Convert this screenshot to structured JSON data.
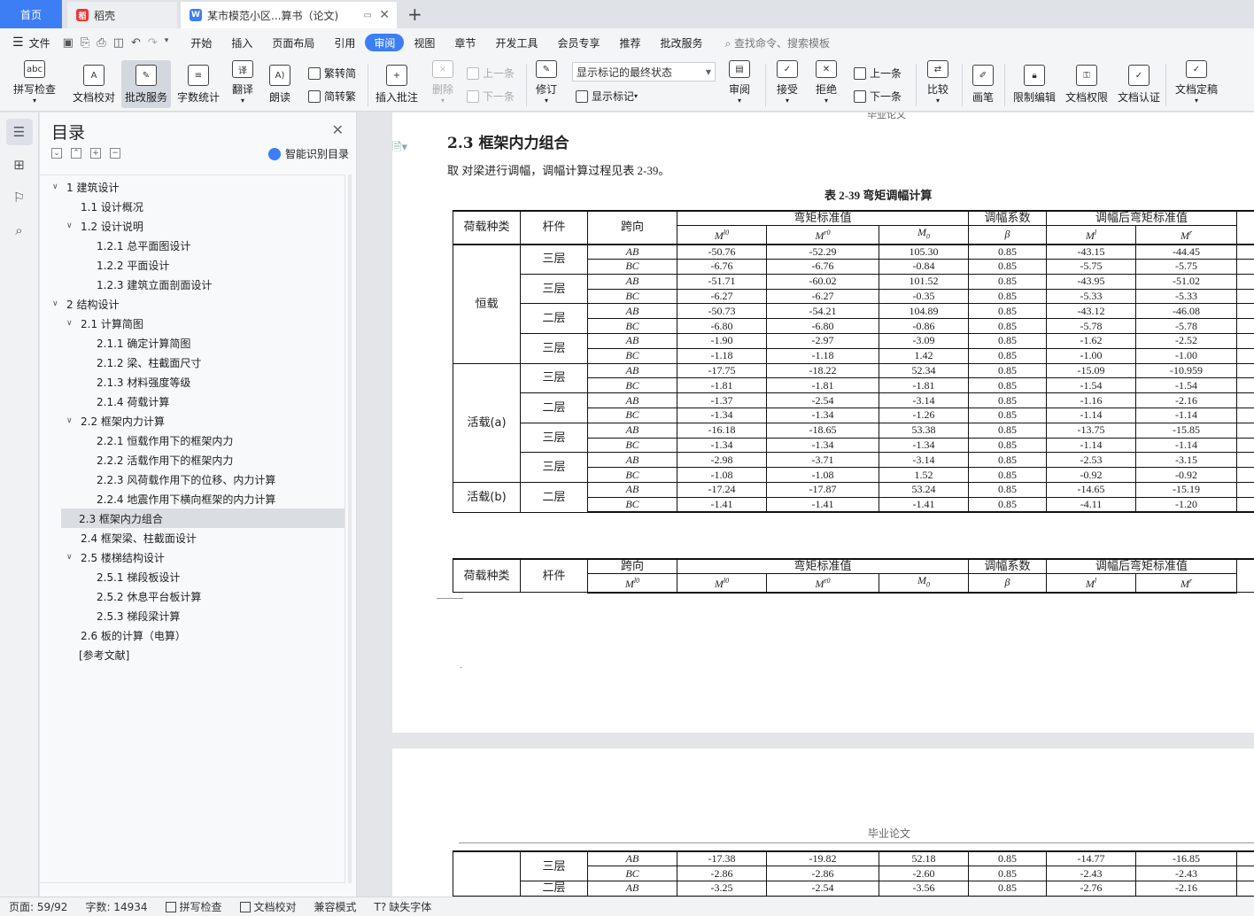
{
  "tabs": {
    "home": "首页",
    "daoke": "稻壳",
    "doc": "某市模范小区...算书（论文)"
  },
  "menu": {
    "file": "文件",
    "items": [
      "开始",
      "插入",
      "页面布局",
      "引用",
      "审阅",
      "视图",
      "章节",
      "开发工具",
      "会员专享",
      "推荐",
      "批改服务"
    ],
    "active_index": 4,
    "search": "查找命令、搜索模板"
  },
  "ribbon": {
    "spell": "拼写检查",
    "proof": "文档校对",
    "correct": "批改服务",
    "wordcount": "字数统计",
    "translate": "翻译",
    "read": "朗读",
    "trad": "繁转简",
    "simp": "简转繁",
    "insert_comment": "插入批注",
    "delete": "删除",
    "prev_comment": "上一条",
    "next_comment": "下一条",
    "revise": "修订",
    "markup_state": "显示标记的最终状态",
    "show_markup": "显示标记",
    "review": "审阅",
    "accept": "接受",
    "reject": "拒绝",
    "prev": "上一条",
    "next": "下一条",
    "compare": "比较",
    "pen": "画笔",
    "restrict": "限制编辑",
    "permission": "文档权限",
    "certify": "文档认证",
    "finalize": "文档定稿"
  },
  "toc": {
    "title": "目录",
    "smart": "智能识别目录",
    "items": [
      {
        "t": "1  建筑设计",
        "lvl": 1,
        "tw": "v"
      },
      {
        "t": "1.1  设计概况",
        "lvl": 2,
        "tw": ""
      },
      {
        "t": "1.2  设计说明",
        "lvl": 2,
        "tw": "v"
      },
      {
        "t": "1.2.1  总平面图设计",
        "lvl": 3,
        "tw": ""
      },
      {
        "t": "1.2.2  平面设计",
        "lvl": 3,
        "tw": ""
      },
      {
        "t": "1.2.3 建筑立面剖面设计",
        "lvl": 3,
        "tw": ""
      },
      {
        "t": "2  结构设计",
        "lvl": 1,
        "tw": "v"
      },
      {
        "t": "2.1  计算简图",
        "lvl": 2,
        "tw": "v"
      },
      {
        "t": "2.1.1  确定计算简图",
        "lvl": 3,
        "tw": ""
      },
      {
        "t": "2.1.2  梁、柱截面尺寸",
        "lvl": 3,
        "tw": ""
      },
      {
        "t": "2.1.3  材料强度等级",
        "lvl": 3,
        "tw": ""
      },
      {
        "t": "2.1.4  荷载计算",
        "lvl": 3,
        "tw": ""
      },
      {
        "t": "2.2  框架内力计算",
        "lvl": 2,
        "tw": "v"
      },
      {
        "t": "2.2.1  恒载作用下的框架内力",
        "lvl": 3,
        "tw": ""
      },
      {
        "t": "2.2.2  活载作用下的框架内力",
        "lvl": 3,
        "tw": ""
      },
      {
        "t": "2.2.3  风荷载作用下的位移、内力计算",
        "lvl": 3,
        "tw": ""
      },
      {
        "t": "2.2.4 地震作用下横向框架的内力计算",
        "lvl": 3,
        "tw": ""
      },
      {
        "t": "2.3  框架内力组合",
        "lvl": 2,
        "tw": "",
        "sel": true
      },
      {
        "t": "2.4  框架梁、柱截面设计",
        "lvl": 2,
        "tw": ""
      },
      {
        "t": "2.5 楼梯结构设计",
        "lvl": 2,
        "tw": "v"
      },
      {
        "t": "2.5.1  梯段板设计",
        "lvl": 3,
        "tw": ""
      },
      {
        "t": "2.5.2  休息平台板计算",
        "lvl": 3,
        "tw": ""
      },
      {
        "t": "2.5.3  梯段梁计算",
        "lvl": 3,
        "tw": ""
      },
      {
        "t": "2.6 板的计算（电算）",
        "lvl": 2,
        "tw": ""
      },
      {
        "t": "[参考文献]",
        "lvl": 0,
        "tw": ""
      }
    ]
  },
  "doc": {
    "header_cut": "毕业论文",
    "section_title": "2.3  框架内力组合",
    "para": "取  对梁进行调幅，调幅计算过程见表 2-39。",
    "caption": "表 2-39   弯矩调幅计算",
    "page2_header": "毕业论文",
    "head1": [
      "荷载种类",
      "杆件",
      "跨向",
      "弯矩标准值",
      "调幅系数",
      "调幅后弯矩标准值"
    ],
    "head2": [
      "M^l0",
      "M^r0",
      "M₀",
      "β",
      "M^l",
      "M^r"
    ],
    "head2b": [
      "M^l0",
      "M^l0",
      "M^r0",
      "M₀",
      "β",
      "M^l",
      "M^r"
    ],
    "rows": [
      {
        "load": "恒载",
        "floor": "三层",
        "span": "AB",
        "v": [
          "-50.76",
          "-52.29",
          "105.30",
          "0.85",
          "-43.15",
          "-44.45"
        ]
      },
      {
        "span": "BC",
        "v": [
          "-6.76",
          "-6.76",
          "-0.84",
          "0.85",
          "-5.75",
          "-5.75"
        ]
      },
      {
        "floor": "三层",
        "span": "AB",
        "v": [
          "-51.71",
          "-60.02",
          "101.52",
          "0.85",
          "-43.95",
          "-51.02"
        ]
      },
      {
        "span": "BC",
        "v": [
          "-6.27",
          "-6.27",
          "-0.35",
          "0.85",
          "-5.33",
          "-5.33"
        ]
      },
      {
        "floor": "二层",
        "span": "AB",
        "v": [
          "-50.73",
          "-54.21",
          "104.89",
          "0.85",
          "-43.12",
          "-46.08"
        ]
      },
      {
        "span": "BC",
        "v": [
          "-6.80",
          "-6.80",
          "-0.86",
          "0.85",
          "-5.78",
          "-5.78"
        ]
      },
      {
        "floor": "三层",
        "span": "AB",
        "v": [
          "-1.90",
          "-2.97",
          "-3.09",
          "0.85",
          "-1.62",
          "-2.52"
        ]
      },
      {
        "span": "BC",
        "v": [
          "-1.18",
          "-1.18",
          "1.42",
          "0.85",
          "-1.00",
          "-1.00"
        ]
      },
      {
        "load": "活载(a)",
        "floor": "三层",
        "span": "AB",
        "v": [
          "-17.75",
          "-18.22",
          "52.34",
          "0.85",
          "-15.09",
          "-10.959"
        ]
      },
      {
        "span": "BC",
        "v": [
          "-1.81",
          "-1.81",
          "-1.81",
          "0.85",
          "-1.54",
          "-1.54"
        ]
      },
      {
        "floor": "二层",
        "span": "AB",
        "v": [
          "-1.37",
          "-2.54",
          "-3.14",
          "0.85",
          "-1.16",
          "-2.16"
        ]
      },
      {
        "span": "BC",
        "v": [
          "-1.34",
          "-1.34",
          "-1.26",
          "0.85",
          "-1.14",
          "-1.14"
        ]
      },
      {
        "floor": "三层",
        "span": "AB",
        "v": [
          "-16.18",
          "-18.65",
          "53.38",
          "0.85",
          "-13.75",
          "-15.85"
        ]
      },
      {
        "span": "BC",
        "v": [
          "-1.34",
          "-1.34",
          "-1.34",
          "0.85",
          "-1.14",
          "-1.14"
        ]
      },
      {
        "floor": "三层",
        "span": "AB",
        "v": [
          "-2.98",
          "-3.71",
          "-3.14",
          "0.85",
          "-2.53",
          "-3.15"
        ]
      },
      {
        "span": "BC",
        "v": [
          "-1.08",
          "-1.08",
          "1.52",
          "0.85",
          "-0.92",
          "-0.92"
        ]
      },
      {
        "load": "活载(b)",
        "floor": "二层",
        "span": "AB",
        "v": [
          "-17.24",
          "-17.87",
          "53.24",
          "0.85",
          "-14.65",
          "-15.19"
        ]
      },
      {
        "span": "BC",
        "v": [
          "-1.41",
          "-1.41",
          "-1.41",
          "0.85",
          "-4.11",
          "-1.20"
        ]
      }
    ],
    "rows2": [
      {
        "floor": "三层",
        "span": "AB",
        "v": [
          "-17.38",
          "-19.82",
          "52.18",
          "0.85",
          "-14.77",
          "-16.85"
        ]
      },
      {
        "span": "BC",
        "v": [
          "-2.86",
          "-2.86",
          "-2.60",
          "0.85",
          "-2.43",
          "-2.43"
        ]
      },
      {
        "floor": "二层",
        "span": "AB",
        "v": [
          "-3.25",
          "-2.54",
          "-3.56",
          "0.85",
          "-2.76",
          "-2.16"
        ]
      }
    ]
  },
  "status": {
    "page": "页面: 59/92",
    "words": "字数: 14934",
    "spell": "拼写检查",
    "proof": "文档校对",
    "compat": "兼容模式",
    "missing_font": "缺失字体"
  }
}
